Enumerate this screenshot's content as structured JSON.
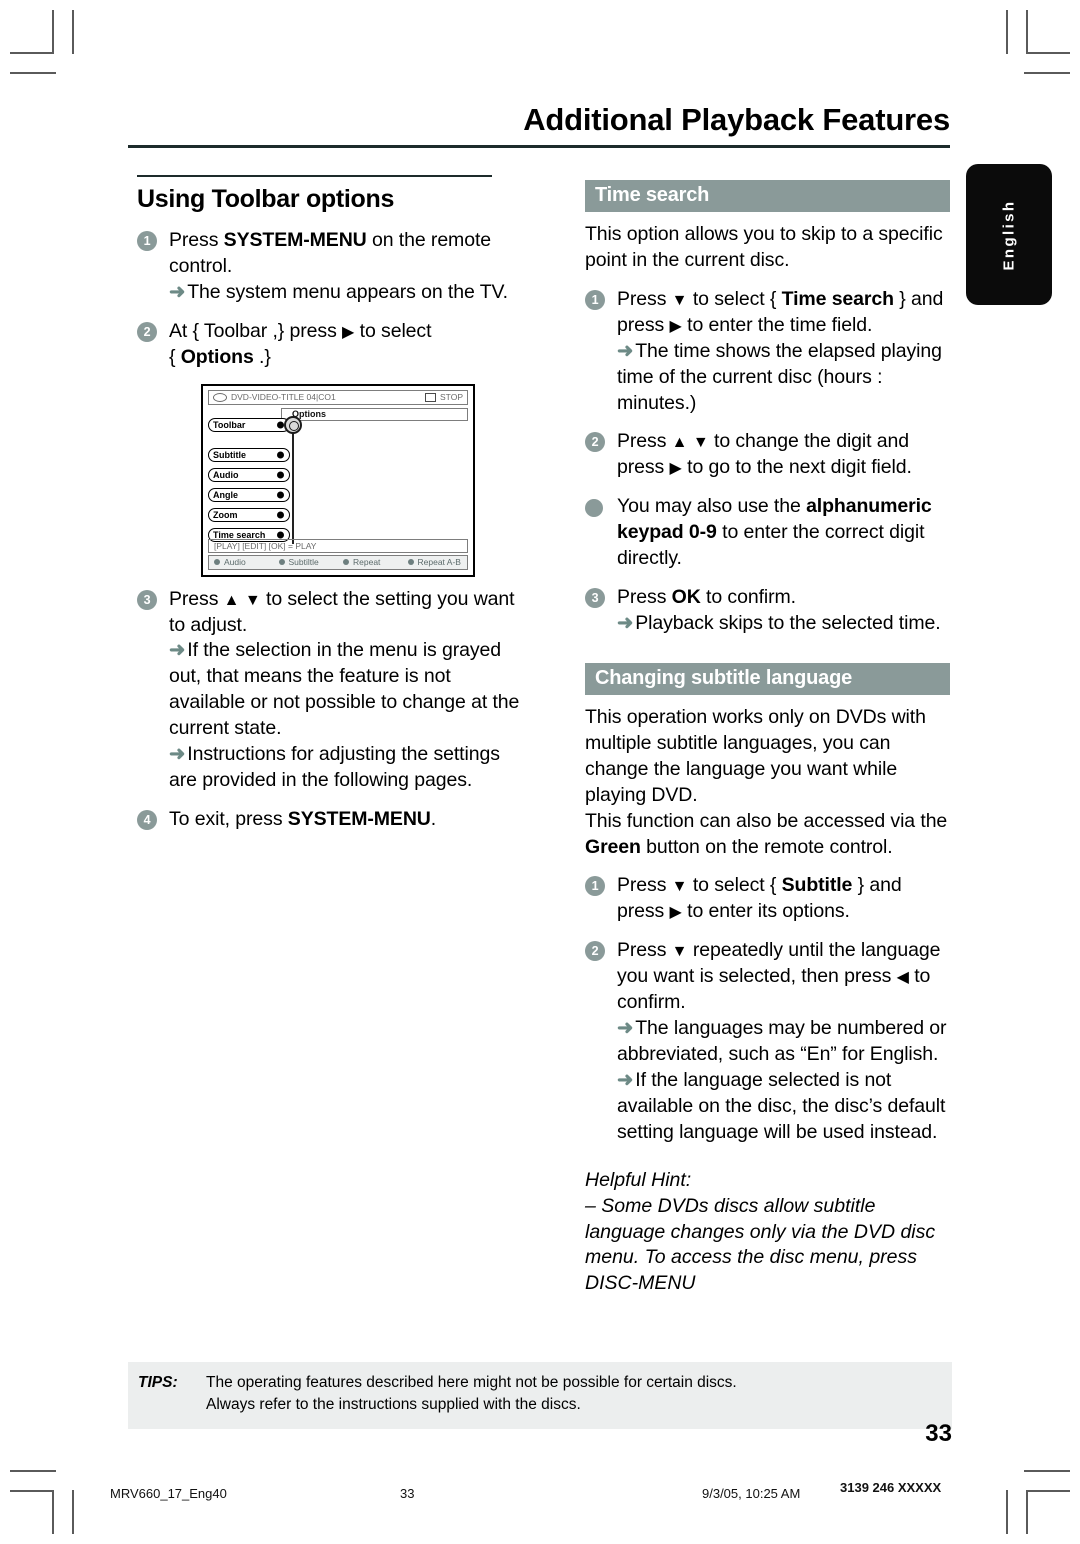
{
  "page_title": "Additional Playback Features",
  "language_tab": "English",
  "left_column": {
    "heading": "Using Toolbar options",
    "step1": {
      "num": "1",
      "line1_pre": "Press ",
      "line1_bold": "SYSTEM-MENU",
      "line1_post": " on the remote control.",
      "result": "The system menu appears on the TV."
    },
    "step2": {
      "num": "2",
      "line1": "At { Toolbar ,} press ",
      "nav": "▶",
      "line2": " to select",
      "line3_pre": "{ ",
      "line3_bold": "Options",
      "line3_post": " .}"
    },
    "step3": {
      "num": "3",
      "line1_pre": "Press ",
      "nav_up": "▲",
      "nav_down": "▼",
      "line1_post": " to select the setting you want to adjust.",
      "result1": "If the selection in the menu is grayed out, that means the feature is not available or not possible to change at the current state.",
      "result2": "Instructions for adjusting the settings are provided in the following pages."
    },
    "step4": {
      "num": "4",
      "line1_pre": "To exit, press ",
      "line1_bold": "SYSTEM-MENU",
      "line1_post": "."
    }
  },
  "osd": {
    "status_left": "DVD-VIDEO-TITLE 04|CO1",
    "status_right": "STOP",
    "options_label": "Options",
    "rows": [
      {
        "label": "Toolbar"
      },
      {
        "label": "Subtitle"
      },
      {
        "label": "Audio"
      },
      {
        "label": "Angle"
      },
      {
        "label": "Zoom"
      },
      {
        "label": "Time search"
      }
    ],
    "info_bar": "[PLAY] [EDIT] [OK] = PLAY",
    "legend": [
      "Audio",
      "Subtiltle",
      "Repeat",
      "Repeat A-B"
    ]
  },
  "right_column": {
    "section1": {
      "title": "Time search",
      "intro": "This option allows you to skip to a specific point in the current disc.",
      "step1": {
        "num": "1",
        "pre": "Press ",
        "nav_down": "▼",
        "mid": " to select { ",
        "bold": "Time search",
        "post": " } and press ",
        "nav_right": "▶",
        "tail": " to enter the time field.",
        "result": "The time shows the elapsed playing time of the current disc (hours : minutes.)"
      },
      "step2": {
        "num": "2",
        "pre": "Press ",
        "nav_up": "▲",
        "nav_down": "▼",
        "mid": " to change the digit and press ",
        "nav_right": "▶",
        "post": " to go to the next digit field."
      },
      "bullet": {
        "pre": "You may also use the ",
        "bold1": "alphanumeric keypad 0-9",
        "post": " to enter the correct digit directly."
      },
      "step3": {
        "num": "3",
        "pre": "Press ",
        "bold": "OK",
        "post": " to confirm.",
        "result": "Playback skips to the selected time."
      }
    },
    "section2": {
      "title": "Changing subtitle language",
      "intro1": "This operation works only on DVDs with multiple subtitle languages, you can change the language you want while playing DVD.",
      "intro2_pre": "This function can also be accessed via the ",
      "intro2_bold": "Green",
      "intro2_post": " button on the remote control.",
      "step1": {
        "num": "1",
        "pre": "Press ",
        "nav_down": "▼",
        "mid": " to select { ",
        "bold": "Subtitle",
        "post": " } and press ",
        "nav_right": "▶",
        "tail": " to enter its options."
      },
      "step2": {
        "num": "2",
        "pre": "Press ",
        "nav_down": "▼",
        "mid": " repeatedly until the language you want is selected, then press ",
        "nav_left": "◀",
        "post": " to confirm.",
        "result1": "The languages may be numbered or abbreviated, such as “En” for English.",
        "result2": "If the language selected is not available on the disc, the disc’s default setting language will be used instead."
      },
      "hint_title": "Helpful Hint:",
      "hint_body": "–  Some DVDs discs allow subtitle language changes only via the DVD disc menu. To access the disc menu, press DISC-MENU"
    }
  },
  "tips": {
    "label": "TIPS:",
    "line1": "The operating features described here might not be possible for certain discs.",
    "line2": "Always refer to the instructions supplied with the discs."
  },
  "page_number": "33",
  "print_footer": {
    "file": "MRV660_17_Eng40",
    "page": "33",
    "date": "9/3/05, 10:25 AM",
    "code": "3139 246 XXXXX"
  },
  "colors": {
    "accent_bar": "#8a9a99",
    "arrow": "#6d8a86",
    "tips_bg": "#eceeee",
    "tab_bg": "#0b0b0b"
  }
}
